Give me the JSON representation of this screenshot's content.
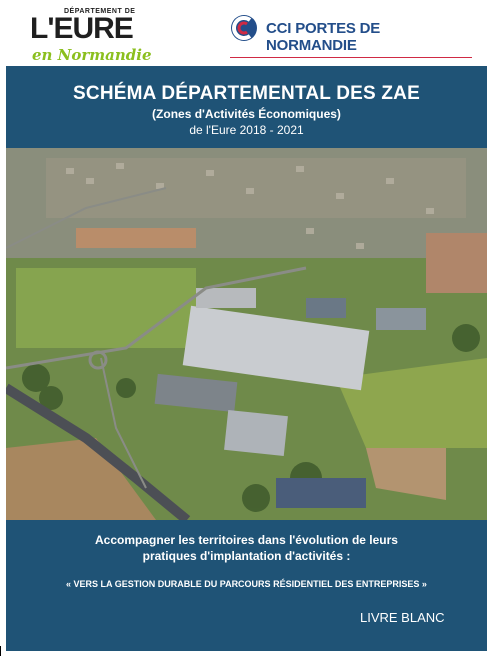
{
  "logos": {
    "eure": {
      "department": "DÉPARTEMENT DE",
      "name": "L'EURE",
      "region": "en Normandie"
    },
    "cci": {
      "name": "CCI PORTES DE NORMANDIE"
    }
  },
  "cover": {
    "title": "SCHÉMA DÉPARTEMENTAL DES ZAE",
    "subtitle": "(Zones d'Activités Économiques)",
    "years": "de l'Eure 2018 - 2021",
    "lead_line1": "Accompagner les territoires dans l'évolution de leurs",
    "lead_line2": "pratiques d'implantation d'activités :",
    "quote": "« VERS LA GESTION DURABLE DU PARCOURS RÉSIDENTIEL DES ENTREPRISES »",
    "badge": "LIVRE BLANC"
  },
  "colors": {
    "panel": "#1f5376",
    "eure_green": "#8bbf1e",
    "cci_blue": "#234e8a",
    "cci_red": "#d02a44"
  }
}
